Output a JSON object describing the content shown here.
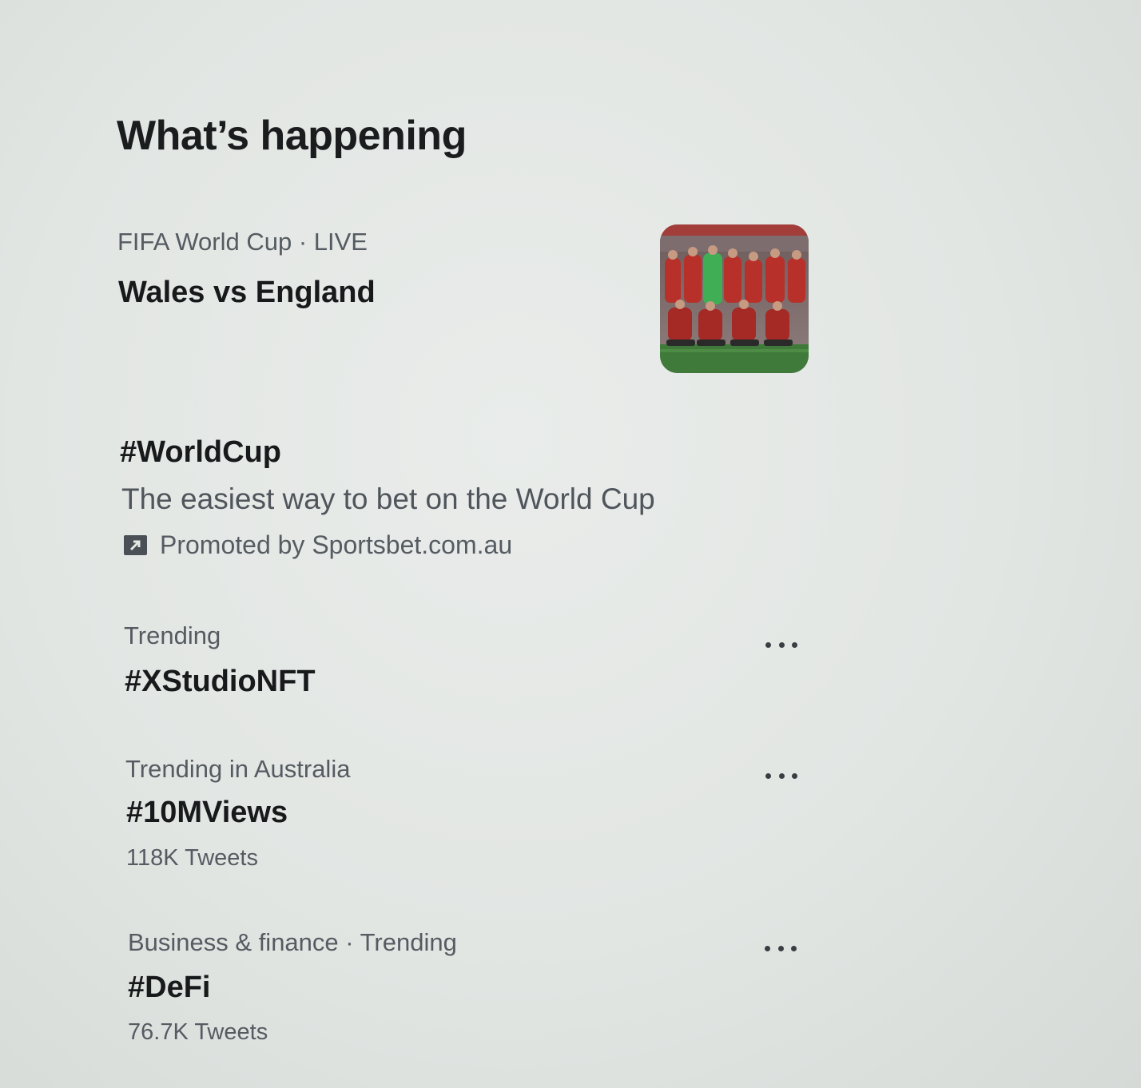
{
  "section": {
    "title": "What’s happening"
  },
  "trends": [
    {
      "meta": "FIFA World Cup · LIVE",
      "title": "Wales vs England",
      "image": "team-photo"
    },
    {
      "title": "#WorldCup",
      "description": "The easiest way to bet on the World Cup",
      "promoted": "Promoted by Sportsbet.com.au",
      "promoted_icon": "promoted-arrow-icon"
    },
    {
      "meta": "Trending",
      "title": "#XStudioNFT",
      "more_icon": "more-options-icon"
    },
    {
      "meta": "Trending in Australia",
      "title": "#10MViews",
      "count": "118K Tweets",
      "more_icon": "more-options-icon"
    },
    {
      "meta": "Business & finance · Trending",
      "title": "#DeFi",
      "count": "76.7K Tweets",
      "more_icon": "more-options-icon"
    }
  ],
  "colors": {
    "background": "#e4e8e5",
    "text_primary": "#1b1d1f",
    "text_secondary": "#555b61",
    "jersey_red": "#b8302a",
    "goalkeeper_green": "#3fae55",
    "pitch_green": "#3f7a3a"
  }
}
